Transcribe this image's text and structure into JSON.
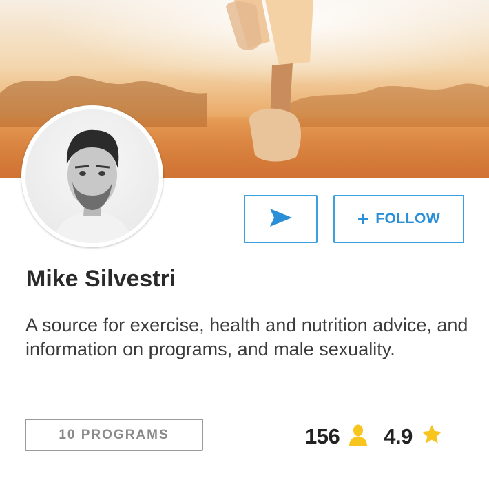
{
  "profile": {
    "name": "Mike Silvestri",
    "bio": "A source for exercise, health and nutrition advice, and information on programs, and male sexuality."
  },
  "actions": {
    "send_icon": "send-icon",
    "follow_plus": "+",
    "follow_label": "FOLLOW"
  },
  "programs": {
    "label": "10 PROGRAMS"
  },
  "stats": {
    "followers": "156",
    "followers_icon": "user-icon",
    "rating": "4.9",
    "rating_icon": "star-icon"
  },
  "colors": {
    "accent": "#3b9fe0",
    "icon_yellow": "#f7c51e",
    "text_dark": "#2a2a2a",
    "button_grey": "#9b9b9b"
  }
}
